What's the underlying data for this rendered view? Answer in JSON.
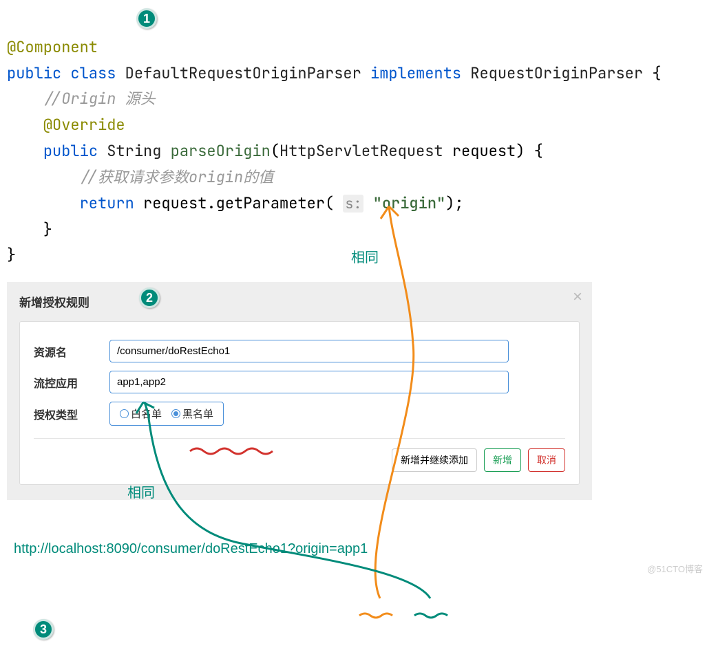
{
  "badges": {
    "one": "1",
    "two": "2",
    "three": "3"
  },
  "code": {
    "annotation": "@Component",
    "public": "public",
    "class": "class",
    "className": "DefaultRequestOriginParser",
    "implements": "implements",
    "iface": "RequestOriginParser",
    "brace": "{",
    "comment1": "//Origin 源头",
    "override": "@Override",
    "ret": "String",
    "method": "parseOrigin",
    "paramType": "HttpServletRequest",
    "paramName": "request",
    "comment2": "//获取请求参数origin的值",
    "return": "return",
    "call": "request.getParameter(",
    "hint": "s:",
    "strVal": "\"origin\"",
    "tail": ");"
  },
  "annoSame1": "相同",
  "annoSame2": "相同",
  "dialog": {
    "title": "新增授权规则",
    "close": "×",
    "fields": {
      "resourceLabel": "资源名",
      "resourceValue": "/consumer/doRestEcho1",
      "appLabel": "流控应用",
      "appValue": "app1,app2",
      "typeLabel": "授权类型",
      "whitelist": "白名单",
      "blacklist": "黑名单"
    },
    "buttons": {
      "addContinue": "新增并继续添加",
      "add": "新增",
      "cancel": "取消"
    }
  },
  "url": "http://localhost:8090/consumer/doRestEcho1?origin=app1",
  "watermark": "@51CTO博客"
}
